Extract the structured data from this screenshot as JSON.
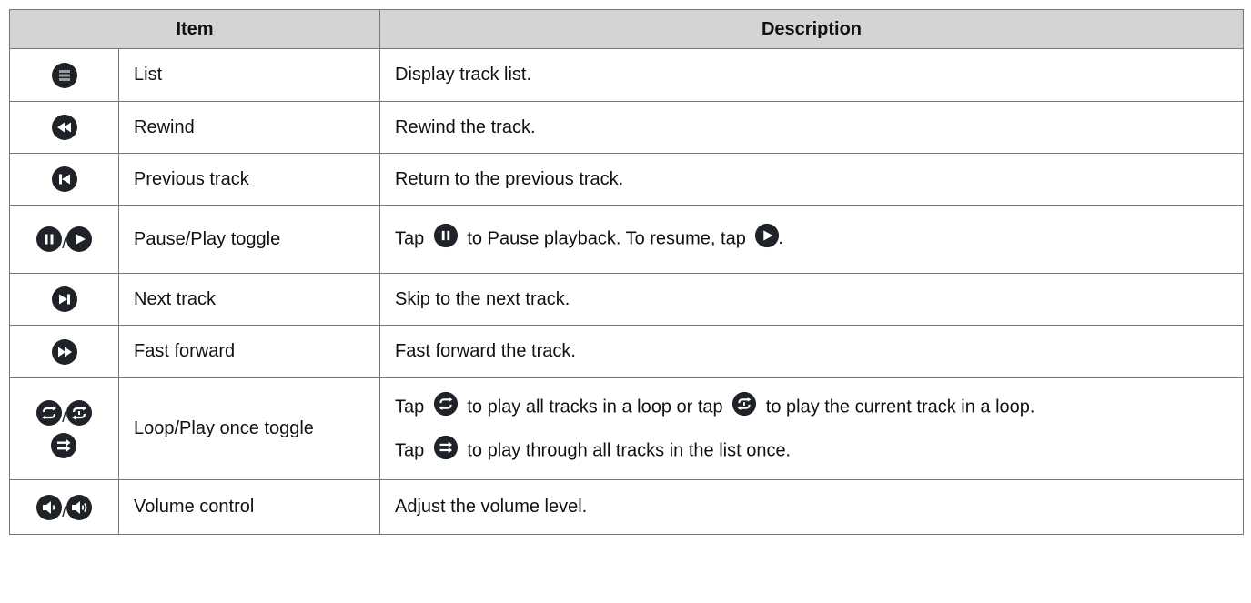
{
  "headers": {
    "item": "Item",
    "description": "Description"
  },
  "rows": [
    {
      "label": "List",
      "description": "Display track list."
    },
    {
      "label": "Rewind",
      "description": "Rewind the track."
    },
    {
      "label": "Previous track",
      "description": "Return to the previous track."
    },
    {
      "label": "Pause/Play toggle",
      "desc_parts": [
        "Tap",
        "to Pause playback. To resume, tap",
        "."
      ]
    },
    {
      "label": "Next track",
      "description": "Skip to the next track."
    },
    {
      "label": "Fast forward",
      "description": "Fast forward the track."
    },
    {
      "label": "Loop/Play once toggle",
      "line1": [
        "Tap",
        "to play all tracks in a loop or tap",
        "to play the current track in a loop."
      ],
      "line2": [
        "Tap",
        "to play through all tracks in the list once."
      ]
    },
    {
      "label": "Volume control",
      "description": "Adjust the volume level."
    }
  ],
  "slash": "/",
  "icon_names": [
    "list-icon",
    "rewind-icon",
    "previous-track-icon",
    "pause-icon",
    "play-icon",
    "next-track-icon",
    "fast-forward-icon",
    "loop-all-icon",
    "loop-one-icon",
    "play-once-icon",
    "volume-down-icon",
    "volume-up-icon"
  ],
  "colors": {
    "header_bg": "#d4d4d4",
    "border": "#777777",
    "icon": "#1f2227"
  }
}
